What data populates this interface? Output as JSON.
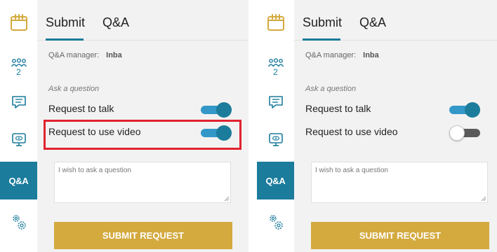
{
  "panels": [
    {
      "tabs": {
        "submit": "Submit",
        "qa": "Q&A"
      },
      "participants_count": "2",
      "qa_rail_label": "Q&A",
      "manager": {
        "label": "Q&A manager:",
        "name": "Inba"
      },
      "ask_label": "Ask a question",
      "toggles": [
        {
          "label": "Request to talk",
          "state": "on"
        },
        {
          "label": "Request to use video",
          "state": "on"
        }
      ],
      "question_placeholder": "I wish to ask a question",
      "submit_label": "SUBMIT REQUEST"
    },
    {
      "tabs": {
        "submit": "Submit",
        "qa": "Q&A"
      },
      "participants_count": "2",
      "qa_rail_label": "Q&A",
      "manager": {
        "label": "Q&A manager:",
        "name": "Inba"
      },
      "ask_label": "Ask a question",
      "toggles": [
        {
          "label": "Request to talk",
          "state": "on"
        },
        {
          "label": "Request to use video",
          "state": "off"
        }
      ],
      "question_placeholder": "I wish to ask a question",
      "submit_label": "SUBMIT REQUEST"
    }
  ],
  "colors": {
    "accent": "#1b7c9c",
    "toggle_on_track": "#3398c8",
    "submit_button": "#d4aa3f",
    "highlight_box": "#e0222f",
    "calendar_icon": "#d4aa3f"
  },
  "icons": {
    "rail": [
      "calendar-icon",
      "participants-icon",
      "chat-icon",
      "screen-share-icon",
      "qa-tab",
      "settings-icon"
    ]
  }
}
